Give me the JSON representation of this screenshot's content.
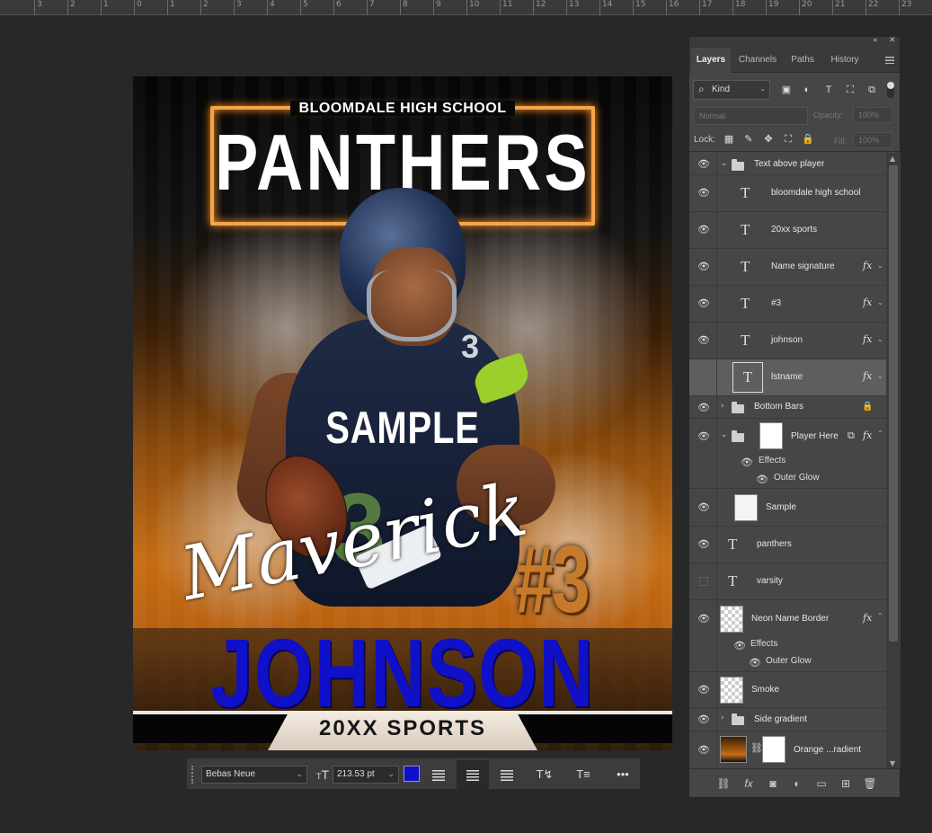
{
  "ruler": {
    "labels": [
      "3",
      "2",
      "1",
      "0",
      "1",
      "2",
      "3",
      "4",
      "5",
      "6",
      "7",
      "8",
      "9",
      "10",
      "11",
      "12",
      "13",
      "14",
      "15",
      "16",
      "17",
      "18",
      "19",
      "20",
      "21",
      "22",
      "23"
    ]
  },
  "artwork": {
    "school_name": "BLOOMDALE HIGH SCHOOL",
    "team_name": "PANTHERS",
    "watermark": "SAMPLE",
    "first_name": "Maverick",
    "last_name": "JOHNSON",
    "jersey_number": "#3",
    "shoulder_number": "3",
    "chest_number": "3",
    "sports_label": "20XX SPORTS"
  },
  "text_toolbar": {
    "font_family": "Bebas Neue",
    "size_icon": "font-size-icon",
    "font_size": "213.53 pt",
    "text_color": "#1010c8",
    "more": "•••"
  },
  "panel": {
    "tabs": [
      {
        "label": "Layers",
        "active": true
      },
      {
        "label": "Channels",
        "active": false
      },
      {
        "label": "Paths",
        "active": false
      },
      {
        "label": "History",
        "active": false
      }
    ],
    "filter_kind": "Kind",
    "blend_mode": "Normal",
    "opacity_label": "Opacity:",
    "opacity_value": "100%",
    "lock_label": "Lock:",
    "fill_label": "Fill:",
    "fill_value": "100%"
  },
  "layers": {
    "group_text_above": "Text above player",
    "bloomdale": "bloomdale high school",
    "sports": "20xx sports",
    "name_signature": "Name signature",
    "number": "#3",
    "johnson": "johnson",
    "lstname": "lstname",
    "bottom_bars": "Bottom Bars",
    "player_here": "Player Here",
    "player_effects": "Effects",
    "player_outer_glow": "Outer Glow",
    "sample": "Sample",
    "panthers": "panthers",
    "varsity": "varsity",
    "neon_border": "Neon Name Border",
    "neon_effects": "Effects",
    "neon_outer_glow": "Outer Glow",
    "smoke": "Smoke",
    "side_gradient": "Side gradient",
    "orange_gradient": "Orange ...radient",
    "fx_label": "fx",
    "type_glyph": "T"
  },
  "colors": {
    "accent_blue": "#1010c8",
    "neon_orange": "#f4a54a",
    "panel_bg": "#464646",
    "app_bg": "#282828"
  }
}
